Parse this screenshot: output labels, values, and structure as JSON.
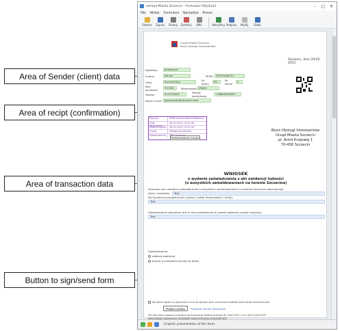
{
  "annotations": {
    "sender": "Area of Sender (client) data",
    "receipt": "Area of recipt (confirmation)",
    "transaction": "Area of transaction data",
    "sign": "Button to sign/send form"
  },
  "window": {
    "title": "eUrząd Miasta Szczecin - Formularz [Wydruk]",
    "controls": [
      "–",
      "□",
      "✕"
    ]
  },
  "menu": [
    "Plik",
    "Widok",
    "Formularz",
    "Narzędzia",
    "Pomoc"
  ],
  "toolbar": [
    {
      "label": "Otwórz",
      "icon": "open-icon",
      "color": "#e2b13c"
    },
    {
      "label": "Zapisz",
      "icon": "save-icon",
      "color": "#3d6fb5"
    },
    {
      "label": "Drukuj",
      "icon": "print-icon",
      "color": "#7a7a7a"
    },
    {
      "label": "Zamknij",
      "icon": "close-doc-icon",
      "color": "#c85a5a"
    },
    {
      "label": "XML",
      "icon": "xml-icon",
      "color": "#8c8c8c"
    },
    {
      "label": "Weryfikuj",
      "icon": "verify-icon",
      "color": "#3b8f4a"
    },
    {
      "label": "Podpisz",
      "icon": "sign-icon",
      "color": "#4c76b8"
    },
    {
      "label": "Wyślij",
      "icon": "send-icon",
      "color": "#b8b8b8"
    },
    {
      "label": "Dalej",
      "icon": "next-icon",
      "color": "#3d6fb5"
    }
  ],
  "form": {
    "office_lines": [
      "Urząd Miasta Szczecin",
      "Biuro Obsługi Interesantów"
    ],
    "date": "Szczecin, dnia 28-02-2011",
    "sender": {
      "labels": [
        "Nazwisko",
        "Imiona",
        "Ulica",
        "Kod pocztowy",
        "Telefon",
        "Adres e-mail"
      ],
      "surname": "Kowalczyk",
      "first_name": "Daniel",
      "pesel_label": "PESEL",
      "pesel": "93021608721",
      "street": "Szczecińska",
      "house_label": "Nr domu",
      "house": "69",
      "flat_label": "Nr lokalu",
      "flat": "4",
      "postcode": "70-500",
      "city_label": "Miejscowość",
      "city": "Zieleń",
      "phone": "913133645",
      "mobile_label": "Telefon komórkowy",
      "mobile": "+48605540657",
      "email": "jkowalczyk@utonium.com"
    },
    "receipt": {
      "headers": [
        "Pozycja",
        "Elektroniczne Biuro Podawcze"
      ],
      "rows": [
        [
          "Data otrzymania",
          "28-02-2011 12:41:44"
        ],
        [
          "Data przyjęcia",
          "28-02-2011 12:41:44"
        ],
        [
          "Urząd",
          "Ewidencja ludności"
        ],
        [
          "Potwierdzenie",
          "UPO (wydruk)"
        ]
      ],
      "button": "Potwierdzenie Urzędu"
    },
    "recipient": [
      "Biuro Obsługi Interesantów",
      "Urząd Miasta Szczecin",
      "pl. Armii Krajowej 1",
      "70-456 Szczecin"
    ],
    "title": "WNIOSEK",
    "subtitle": [
      "o wydanie zaświadczenia z akt ewidencji ludności",
      "(o wszystkich zameldowaniach na terenie Szczecina)"
    ],
    "transaction": {
      "line1": "Zwracam się o wydanie zaświadczenia o wszystkich zameldowaniach na terenie Szczecina dotyczącego",
      "line2_label": "(imię i nazwisko)",
      "line2_value": "Test",
      "line3": "Do Szczecina przybyłem/am (podać z jakiej miejscowości i kiedy)",
      "field3": "Test",
      "line4": "Zaświadczenie potrzebne jest w celu przedłożenia w (podać dokładną nazwę instytucji)",
      "field4": "Test"
    },
    "delivery": {
      "label": "Zaświadczenie:",
      "options": [
        "odbiorę osobiście",
        "proszę o przesłanie pocztą na adres"
      ]
    },
    "sign": {
      "consent": "Wyrażam zgodę na doręczanie mi w tej sprawie pism za pomocą środków komunikacji elektronicznej",
      "button": "Podpisz podpis",
      "link": "Podpisał: Daniel Kowalczyk",
      "info1": "Ten formularz zostanie przesłany do formularza elektronicznego ID: 0342 2007 1111 0013 0094 0787",
      "info2": "Identyfikator dokumentu: 4b5a0e83-9d3a-0e3f-a01a-d7fa4c667801",
      "status": "Problem na poziomie: w trakcie rzutu w stanie ładowania.",
      "btn_preview": "Przejdź do podglądu",
      "btn_change": "Zmień treść dokumentu"
    }
  },
  "status": "Graphic presentation of the form"
}
